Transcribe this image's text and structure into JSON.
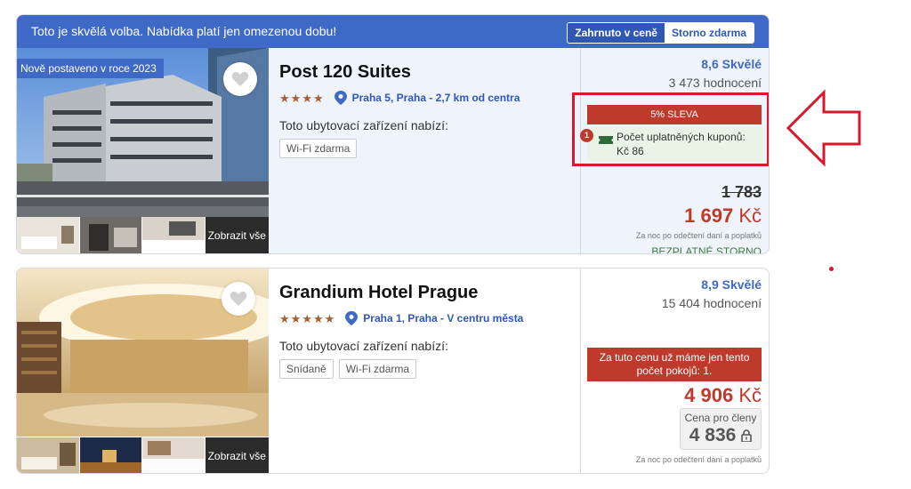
{
  "colors": {
    "accent_blue": "#3f69c6",
    "sale_red": "#bd3a2c",
    "highlight_red": "#d8192d",
    "star_brown": "#a55f32",
    "green_text": "#3d7a3d",
    "coupon_green": "#e9f4e6"
  },
  "hotels": [
    {
      "promo_text": "Toto je skvělá volba. Nabídka platí jen omezenou dobu!",
      "promo_tabs": [
        "Zahrnuto v ceně",
        "Storno zdarma"
      ],
      "new_badge": "Nově postaveno v roce 2023",
      "name": "Post 120 Suites",
      "stars": 4,
      "location": "Praha 5, Praha - 2,7 km od centra",
      "offers_label": "Toto ubytovací zařízení nabízí:",
      "amenities": [
        "Wi-Fi zdarma"
      ],
      "more_photos": "Zobrazit vše",
      "rating": "8,6 Skvělé",
      "reviews": "3 473 hodnocení",
      "discount": "5% SLEVA",
      "coupon_count": "1",
      "coupon_text": "Počet uplatněných kuponů: Kč 86",
      "old_price": "1 783",
      "price": "1 697",
      "currency": "Kč",
      "price_note": "Za noc po odečtení daní a poplatků",
      "cancellation": "BEZPLATNÉ STORNO"
    },
    {
      "name": "Grandium Hotel Prague",
      "stars": 5,
      "location": "Praha 1, Praha - V centru města",
      "offers_label": "Toto ubytovací zařízení nabízí:",
      "amenities": [
        "Snídaně",
        "Wi-Fi zdarma"
      ],
      "more_photos": "Zobrazit vše",
      "rating": "8,9 Skvělé",
      "reviews": "15 404 hodnocení",
      "availability": "Za tuto cenu už máme jen tento počet pokojů: 1.",
      "price": "4 906",
      "currency": "Kč",
      "member_label": "Cena pro členy",
      "member_price": "4 836",
      "price_note": "Za noc po odečtení daní a poplatků"
    }
  ]
}
